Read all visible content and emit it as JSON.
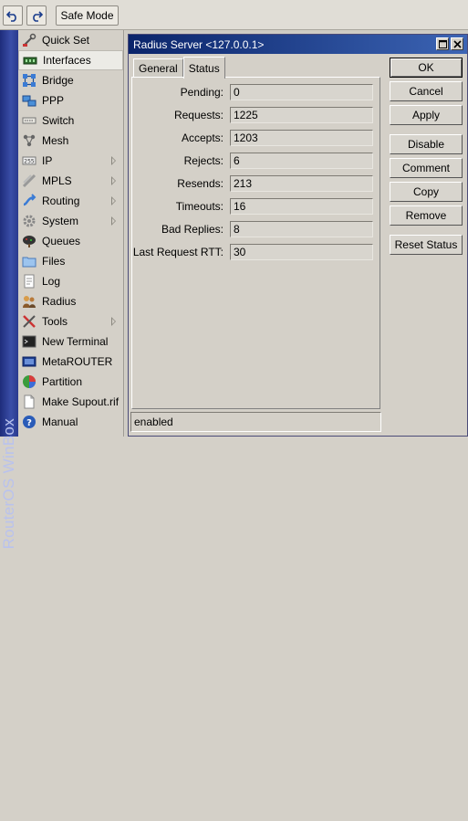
{
  "toolbar": {
    "undo_icon": "undo-icon",
    "redo_icon": "redo-icon",
    "safe_mode_label": "Safe Mode"
  },
  "brand": {
    "text": "RouterOS WinBox"
  },
  "menu": {
    "items": [
      {
        "label": "Quick Set",
        "icon": "quick-set-icon",
        "submenu": false
      },
      {
        "label": "Interfaces",
        "icon": "interfaces-icon",
        "submenu": false,
        "selected": true
      },
      {
        "label": "Bridge",
        "icon": "bridge-icon",
        "submenu": false
      },
      {
        "label": "PPP",
        "icon": "ppp-icon",
        "submenu": false
      },
      {
        "label": "Switch",
        "icon": "switch-icon",
        "submenu": false
      },
      {
        "label": "Mesh",
        "icon": "mesh-icon",
        "submenu": false
      },
      {
        "label": "IP",
        "icon": "ip-icon",
        "submenu": true
      },
      {
        "label": "MPLS",
        "icon": "mpls-icon",
        "submenu": true
      },
      {
        "label": "Routing",
        "icon": "routing-icon",
        "submenu": true
      },
      {
        "label": "System",
        "icon": "system-icon",
        "submenu": true
      },
      {
        "label": "Queues",
        "icon": "queues-icon",
        "submenu": false
      },
      {
        "label": "Files",
        "icon": "files-icon",
        "submenu": false
      },
      {
        "label": "Log",
        "icon": "log-icon",
        "submenu": false
      },
      {
        "label": "Radius",
        "icon": "radius-icon",
        "submenu": false
      },
      {
        "label": "Tools",
        "icon": "tools-icon",
        "submenu": true
      },
      {
        "label": "New Terminal",
        "icon": "terminal-icon",
        "submenu": false
      },
      {
        "label": "MetaROUTER",
        "icon": "metarouter-icon",
        "submenu": false
      },
      {
        "label": "Partition",
        "icon": "partition-icon",
        "submenu": false
      },
      {
        "label": "Make Supout.rif",
        "icon": "supout-icon",
        "submenu": false
      },
      {
        "label": "Manual",
        "icon": "manual-icon",
        "submenu": false
      }
    ]
  },
  "dialog": {
    "title": "Radius Server <127.0.0.1>",
    "tabs": [
      {
        "label": "General",
        "active": false
      },
      {
        "label": "Status",
        "active": true
      }
    ],
    "fields": [
      {
        "label": "Pending:",
        "value": "0"
      },
      {
        "label": "Requests:",
        "value": "1225"
      },
      {
        "label": "Accepts:",
        "value": "1203"
      },
      {
        "label": "Rejects:",
        "value": "6"
      },
      {
        "label": "Resends:",
        "value": "213"
      },
      {
        "label": "Timeouts:",
        "value": "16"
      },
      {
        "label": "Bad Replies:",
        "value": "8"
      },
      {
        "label": "Last Request RTT:",
        "value": "30"
      }
    ],
    "buttons": {
      "ok": "OK",
      "cancel": "Cancel",
      "apply": "Apply",
      "disable": "Disable",
      "comment": "Comment",
      "copy": "Copy",
      "remove": "Remove",
      "reset_status": "Reset Status"
    },
    "status": "enabled"
  }
}
